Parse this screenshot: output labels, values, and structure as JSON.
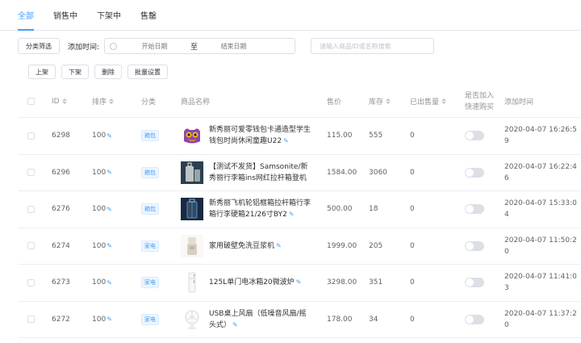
{
  "tabs": [
    {
      "label": "全部"
    },
    {
      "label": "销售中"
    },
    {
      "label": "下架中"
    },
    {
      "label": "售罄"
    }
  ],
  "filters": {
    "category_button": "分类筛选",
    "time_label": "添加时间:",
    "start_placeholder": "开始日期",
    "range_separator": "至",
    "end_placeholder": "结束日期",
    "search_placeholder": "请输入商品ID或名称搜索"
  },
  "actions": {
    "list": "上架",
    "unlist": "下架",
    "delete": "删除",
    "batch": "批量设置"
  },
  "columns": {
    "id": "ID",
    "sort": "排序",
    "category": "分类",
    "name": "商品名称",
    "price": "售价",
    "stock": "库存",
    "sold": "已出售量",
    "quick_line1": "是否加入",
    "quick_line2": "快速购买",
    "time": "添加时间"
  },
  "colors": {
    "accent": "#409eff"
  },
  "rows": [
    {
      "id": "6298",
      "sort": "100",
      "category": "箱包",
      "name": "新秀丽可爱零钱包卡通造型学生钱包时尚休闲童趣U22",
      "thumb": "purple-wallet",
      "price": "115.00",
      "stock": "555",
      "sold": "0",
      "quick": false,
      "time": "2020-04-07 16:26:59"
    },
    {
      "id": "6296",
      "sort": "100",
      "category": "箱包",
      "name": "【测试不发货】Samsonite/新秀丽行李箱ins网红拉杆箱登机旅...",
      "thumb": "silver-suitcase",
      "price": "1584.00",
      "stock": "3060",
      "sold": "0",
      "quick": false,
      "time": "2020-04-07 16:22:46"
    },
    {
      "id": "6276",
      "sort": "100",
      "category": "箱包",
      "name": "新秀丽飞机轮铝框箱拉杆箱行李箱行李硬箱21/26寸BY2",
      "thumb": "dark-suitcase",
      "price": "500.00",
      "stock": "18",
      "sold": "0",
      "quick": false,
      "time": "2020-04-07 15:33:04"
    },
    {
      "id": "6274",
      "sort": "100",
      "category": "家电",
      "name": "家用破壁免洗豆浆机",
      "thumb": "soymilk-maker",
      "price": "1999.00",
      "stock": "205",
      "sold": "0",
      "quick": false,
      "time": "2020-04-07 11:50:20"
    },
    {
      "id": "6273",
      "sort": "100",
      "category": "家电",
      "name": "125L单门电冰箱20微波炉",
      "thumb": "fridge",
      "price": "3298.00",
      "stock": "351",
      "sold": "0",
      "quick": false,
      "time": "2020-04-07 11:41:03"
    },
    {
      "id": "6272",
      "sort": "100",
      "category": "家电",
      "name": "USB桌上风扇（低噪音风扇/摇头式）",
      "thumb": "usb-fan",
      "price": "178.00",
      "stock": "34",
      "sold": "0",
      "quick": false,
      "time": "2020-04-07 11:37:20"
    }
  ]
}
